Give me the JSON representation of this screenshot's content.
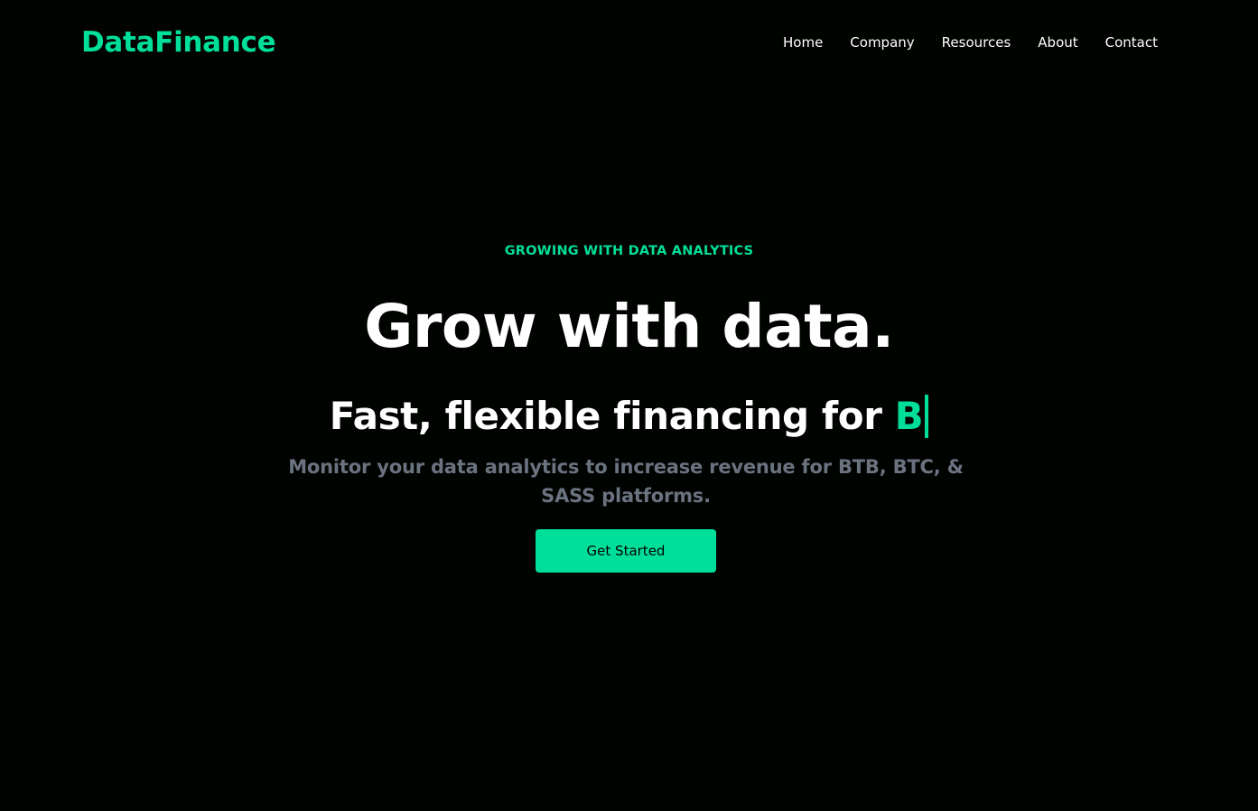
{
  "brand": {
    "name": "DataFinance",
    "accent_color": "#00df9a",
    "background_color": "#000300"
  },
  "nav": {
    "items": [
      "Home",
      "Company",
      "Resources",
      "About",
      "Contact"
    ]
  },
  "hero": {
    "eyebrow": "GROWING WITH DATA ANALYTICS",
    "headline": "Grow with data.",
    "subhead_prefix": "Fast, flexible financing for",
    "typed_text": "B",
    "description": "Monitor your data analytics to increase revenue for BTB, BTC, & SASS platforms.",
    "cta_label": "Get Started"
  }
}
